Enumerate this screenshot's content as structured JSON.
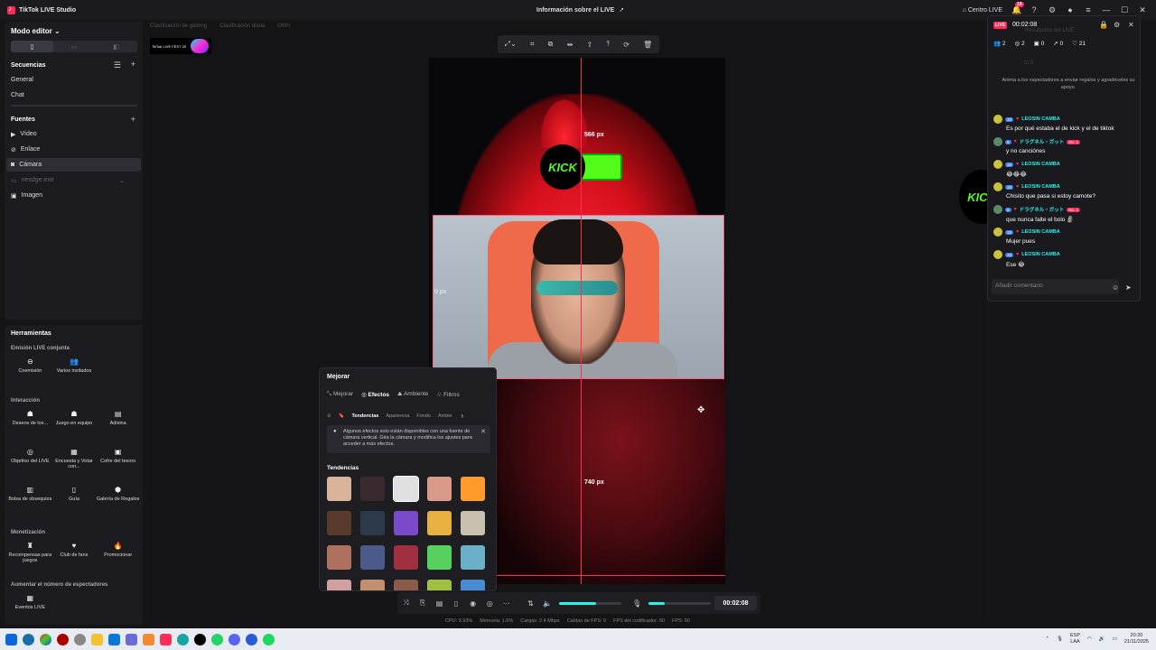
{
  "app": {
    "title": "TikTok LIVE Studio",
    "center_title": "Información sobre el LIVE",
    "centro_live": "Centro LIVE",
    "notif_count": "19"
  },
  "sidebar": {
    "mode": "Modo editor",
    "sequences_title": "Secuencias",
    "sequences": [
      "General",
      "Chat"
    ],
    "sources_title": "Fuentes",
    "sources": [
      {
        "label": "Vídeo",
        "icon": "play-icon"
      },
      {
        "label": "Enlace",
        "icon": "link-icon"
      },
      {
        "label": "Cámara",
        "icon": "camera-icon"
      },
      {
        "label": "nesdge.exe",
        "icon": "window-icon"
      },
      {
        "label": "Imagen",
        "icon": "image-icon"
      }
    ]
  },
  "tools": {
    "title": "Herramientas",
    "cat1": "Emisión LIVE conjunta",
    "group1": [
      {
        "label": "Coemisión",
        "icon": "link-icon"
      },
      {
        "label": "Varios invitados",
        "icon": "people-icon"
      }
    ],
    "cat2": "Interacción",
    "group2": [
      {
        "label": "Deseos de los...",
        "icon": "wish-icon"
      },
      {
        "label": "Juego en equipo",
        "icon": "team-icon"
      },
      {
        "label": "Adivina",
        "icon": "guess-icon"
      },
      {
        "label": "Objetivo del LIVE",
        "icon": "target-icon"
      },
      {
        "label": "Encuesta y Votar con...",
        "icon": "poll-icon"
      },
      {
        "label": "Cofre del tesoro",
        "icon": "chest-icon"
      },
      {
        "label": "Bolsa de obsequios",
        "icon": "bag-icon"
      },
      {
        "label": "Guía",
        "icon": "book-icon"
      },
      {
        "label": "Galería de Regalos",
        "icon": "gallery-icon"
      }
    ],
    "cat3": "Monetización",
    "group3": [
      {
        "label": "Recompensas para juegos",
        "icon": "reward-icon"
      },
      {
        "label": "Club de fans",
        "icon": "heart-icon"
      },
      {
        "label": "Promocionar",
        "icon": "fire-icon"
      }
    ],
    "cat4": "Aumentar el número de espectadores",
    "group4": [
      {
        "label": "Eventos LIVE",
        "icon": "calendar-icon"
      }
    ]
  },
  "canvas": {
    "tabs": [
      "Clasificación de gaming",
      "Clasificación diaria",
      "Ofrtrt"
    ],
    "promo_text": "TikTok LIVE FEST 25",
    "px_top": "566 px",
    "px_left": "9 px",
    "px_bottom": "740 px",
    "kick_text": "KICK"
  },
  "effects": {
    "title": "Mejorar",
    "tabs": [
      "Mejorar",
      "Efectos",
      "Ambiente",
      "Filtros"
    ],
    "subtabs": [
      "Tendencias",
      "Apariencia",
      "Fondo",
      "Ambie"
    ],
    "notice": "Algunos efectos solo están disponibles con una fuente de cámara vertical. Gira la cámara y modifica los ajustes para acceder a más efectos.",
    "trend_title": "Tendencias",
    "thumb_colors": [
      "#d9b49a",
      "#3a2a30",
      "#e0e0e0",
      "#d99a8a",
      "#ff9b2b",
      "#5a3a2a",
      "#2a3a4a",
      "#7a4acb",
      "#e8b040",
      "#c9c0b0",
      "#b07060",
      "#4a5a8a",
      "#a03040",
      "#58d060",
      "#6ab0c8",
      "#d0a0a0",
      "#c09070",
      "#8a5a4a",
      "#a0c040",
      "#4a8ad0"
    ]
  },
  "controls": {
    "time": "00:02:08",
    "volume": 0.6,
    "mic": 0.25
  },
  "stats": [
    "CPU: 3.93%",
    "Memoria: 1.6%",
    "Cargas: 2.4 Mbps",
    "Caídas de FPS: 0",
    "FPS del codificador: 60",
    "FPS: 60"
  ],
  "chat": {
    "live": "LIVE",
    "time": "00:02:08",
    "ghost": "Resultados del LIVE",
    "stats": [
      {
        "icon": "people-icon",
        "value": "2"
      },
      {
        "icon": "eye-icon",
        "value": "2"
      },
      {
        "icon": "gift-icon",
        "value": "0"
      },
      {
        "icon": "share-icon",
        "value": "0"
      },
      {
        "icon": "heart-icon",
        "value": "21"
      }
    ],
    "anima": "Anima a los espectadores a enviar regalos y agradéceles su apoyo.",
    "messages": [
      {
        "level": "10",
        "name": "LEOSIN CAMBA",
        "text": "Es por qué estaba el de kick y el de tiktok",
        "no1": ""
      },
      {
        "level": "6",
        "name": "ドラグネル・ガット",
        "text": "y no canciónes",
        "no1": "No. 1"
      },
      {
        "level": "10",
        "name": "LEOSIN CAMBA",
        "text": "😂😂😂",
        "no1": ""
      },
      {
        "level": "10",
        "name": "LEOSIN CAMBA",
        "text": "Chisito que pasa si estoy camote?",
        "no1": ""
      },
      {
        "level": "6",
        "name": "ドラグネル・ガット",
        "text": "que nunca falte el bolo 🗿",
        "no1": "No. 1"
      },
      {
        "level": "10",
        "name": "LEOSIN CAMBA",
        "text": "Mujer pues",
        "no1": ""
      },
      {
        "level": "10",
        "name": "LEOSIN CAMBA",
        "text": "Ese 😂",
        "no1": ""
      }
    ],
    "placeholder": "Añadir comentario"
  },
  "taskbar": {
    "lang1": "ESP",
    "lang2": "LAA",
    "clock": "20:20",
    "date": "21/11/2025"
  }
}
